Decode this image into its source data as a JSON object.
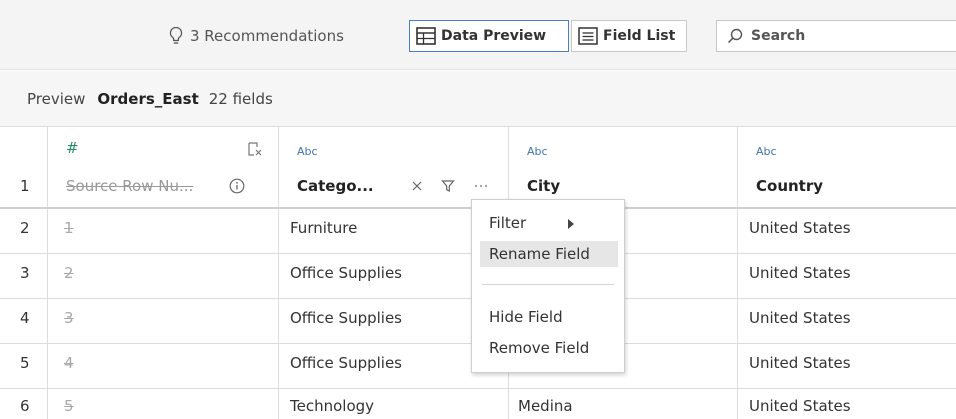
{
  "toolbar": {
    "recommendations_label": "3 Recommendations",
    "data_preview_label": "Data Preview",
    "field_list_label": "Field List",
    "search_placeholder": "Search"
  },
  "preview": {
    "label": "Preview",
    "source_name": "Orders_East",
    "field_count": "22 fields"
  },
  "columns": [
    {
      "type": "#",
      "name": "Source Row Nu..."
    },
    {
      "type": "Abc",
      "name": "Catego..."
    },
    {
      "type": "Abc",
      "name": "City"
    },
    {
      "type": "Abc",
      "name": "Country"
    }
  ],
  "header_row_number": "1",
  "rows": [
    {
      "num": "2",
      "source_row": "1",
      "category": "Furniture",
      "city": "",
      "country": "United States"
    },
    {
      "num": "3",
      "source_row": "2",
      "category": "Office Supplies",
      "city": "",
      "country": "United States"
    },
    {
      "num": "4",
      "source_row": "3",
      "category": "Office Supplies",
      "city": "",
      "country": "United States"
    },
    {
      "num": "5",
      "source_row": "4",
      "category": "Office Supplies",
      "city": "",
      "country": "United States"
    },
    {
      "num": "6",
      "source_row": "5",
      "category": "Technology",
      "city": "Medina",
      "country": "United States"
    }
  ],
  "context_menu": {
    "filter": "Filter",
    "rename": "Rename Field",
    "hide": "Hide Field",
    "remove": "Remove Field"
  },
  "colors": {
    "accent": "#4a7fc0",
    "type_label": "#3f72b0",
    "number_type": "#2a8a6a"
  }
}
